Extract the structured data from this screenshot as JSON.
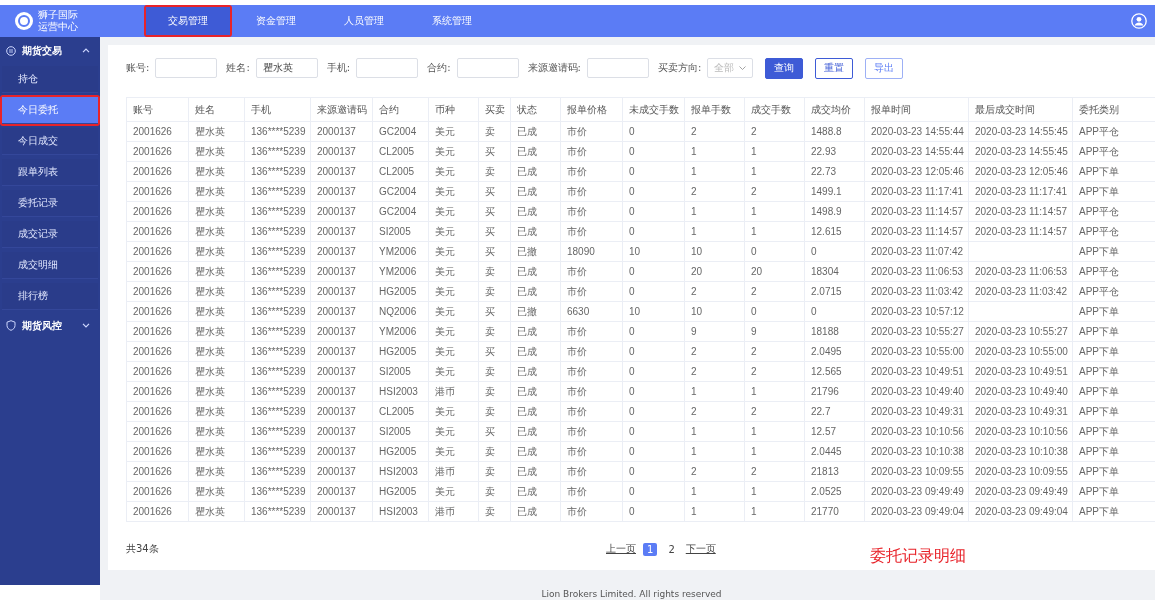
{
  "header": {
    "logo_lines": [
      "狮子国际",
      "运营中心"
    ],
    "tabs": [
      {
        "label": "交易管理",
        "selected": true,
        "annotated": true
      },
      {
        "label": "资金管理",
        "selected": false,
        "annotated": false
      },
      {
        "label": "人员管理",
        "selected": false,
        "annotated": false
      },
      {
        "label": "系统管理",
        "selected": false,
        "annotated": false
      }
    ]
  },
  "sidebar": {
    "groups": [
      {
        "label": "期货交易",
        "expanded": true,
        "items": [
          {
            "label": "持仓",
            "selected": false,
            "annotated": false
          },
          {
            "label": "今日委托",
            "selected": true,
            "annotated": true
          },
          {
            "label": "今日成交",
            "selected": false,
            "annotated": false
          },
          {
            "label": "跟单列表",
            "selected": false,
            "annotated": false
          },
          {
            "label": "委托记录",
            "selected": false,
            "annotated": false
          },
          {
            "label": "成交记录",
            "selected": false,
            "annotated": false
          },
          {
            "label": "成交明细",
            "selected": false,
            "annotated": false
          },
          {
            "label": "排行榜",
            "selected": false,
            "annotated": false
          }
        ]
      },
      {
        "label": "期货风控",
        "expanded": false
      }
    ]
  },
  "filters": [
    {
      "label": "账号:",
      "kind": "input"
    },
    {
      "label": "姓名:",
      "kind": "input",
      "value": "瞿水英"
    },
    {
      "label": "手机:",
      "kind": "input"
    },
    {
      "label": "合约:",
      "kind": "input"
    },
    {
      "label": "来源邀请码:",
      "kind": "input"
    },
    {
      "label": "买卖方向:",
      "kind": "select",
      "placeholder": "全部"
    }
  ],
  "buttons": [
    {
      "label": "查询",
      "kind": "primary"
    },
    {
      "label": "重置",
      "kind": "outline"
    },
    {
      "label": "导出",
      "kind": "light"
    }
  ],
  "table": {
    "columns": [
      "账号",
      "姓名",
      "手机",
      "来源邀请码",
      "合约",
      "币种",
      "买卖",
      "状态",
      "报单价格",
      "未成交手数",
      "报单手数",
      "成交手数",
      "成交均价",
      "报单时间",
      "最后成交时间",
      "委托类别"
    ],
    "rows": [
      [
        "2001626",
        "瞿水英",
        "136****5239",
        "2000137",
        "GC2004",
        "美元",
        "卖",
        "已成",
        "市价",
        "0",
        "2",
        "2",
        "1488.8",
        "2020-03-23 14:55:44",
        "2020-03-23 14:55:45",
        "APP平仓"
      ],
      [
        "2001626",
        "瞿水英",
        "136****5239",
        "2000137",
        "CL2005",
        "美元",
        "买",
        "已成",
        "市价",
        "0",
        "1",
        "1",
        "22.93",
        "2020-03-23 14:55:44",
        "2020-03-23 14:55:45",
        "APP平仓"
      ],
      [
        "2001626",
        "瞿水英",
        "136****5239",
        "2000137",
        "CL2005",
        "美元",
        "卖",
        "已成",
        "市价",
        "0",
        "1",
        "1",
        "22.73",
        "2020-03-23 12:05:46",
        "2020-03-23 12:05:46",
        "APP下单"
      ],
      [
        "2001626",
        "瞿水英",
        "136****5239",
        "2000137",
        "GC2004",
        "美元",
        "买",
        "已成",
        "市价",
        "0",
        "2",
        "2",
        "1499.1",
        "2020-03-23 11:17:41",
        "2020-03-23 11:17:41",
        "APP下单"
      ],
      [
        "2001626",
        "瞿水英",
        "136****5239",
        "2000137",
        "GC2004",
        "美元",
        "买",
        "已成",
        "市价",
        "0",
        "1",
        "1",
        "1498.9",
        "2020-03-23 11:14:57",
        "2020-03-23 11:14:57",
        "APP平仓"
      ],
      [
        "2001626",
        "瞿水英",
        "136****5239",
        "2000137",
        "SI2005",
        "美元",
        "买",
        "已成",
        "市价",
        "0",
        "1",
        "1",
        "12.615",
        "2020-03-23 11:14:57",
        "2020-03-23 11:14:57",
        "APP平仓"
      ],
      [
        "2001626",
        "瞿水英",
        "136****5239",
        "2000137",
        "YM2006",
        "美元",
        "买",
        "已撤",
        "18090",
        "10",
        "10",
        "0",
        "0",
        "2020-03-23 11:07:42",
        null,
        "APP下单"
      ],
      [
        "2001626",
        "瞿水英",
        "136****5239",
        "2000137",
        "YM2006",
        "美元",
        "卖",
        "已成",
        "市价",
        "0",
        "20",
        "20",
        "18304",
        "2020-03-23 11:06:53",
        "2020-03-23 11:06:53",
        "APP平仓"
      ],
      [
        "2001626",
        "瞿水英",
        "136****5239",
        "2000137",
        "HG2005",
        "美元",
        "卖",
        "已成",
        "市价",
        "0",
        "2",
        "2",
        "2.0715",
        "2020-03-23 11:03:42",
        "2020-03-23 11:03:42",
        "APP平仓"
      ],
      [
        "2001626",
        "瞿水英",
        "136****5239",
        "2000137",
        "NQ2006",
        "美元",
        "买",
        "已撤",
        "6630",
        "10",
        "10",
        "0",
        "0",
        "2020-03-23 10:57:12",
        null,
        "APP下单"
      ],
      [
        "2001626",
        "瞿水英",
        "136****5239",
        "2000137",
        "YM2006",
        "美元",
        "卖",
        "已成",
        "市价",
        "0",
        "9",
        "9",
        "18188",
        "2020-03-23 10:55:27",
        "2020-03-23 10:55:27",
        "APP下单"
      ],
      [
        "2001626",
        "瞿水英",
        "136****5239",
        "2000137",
        "HG2005",
        "美元",
        "买",
        "已成",
        "市价",
        "0",
        "2",
        "2",
        "2.0495",
        "2020-03-23 10:55:00",
        "2020-03-23 10:55:00",
        "APP下单"
      ],
      [
        "2001626",
        "瞿水英",
        "136****5239",
        "2000137",
        "SI2005",
        "美元",
        "卖",
        "已成",
        "市价",
        "0",
        "2",
        "2",
        "12.565",
        "2020-03-23 10:49:51",
        "2020-03-23 10:49:51",
        "APP下单"
      ],
      [
        "2001626",
        "瞿水英",
        "136****5239",
        "2000137",
        "HSI2003",
        "港币",
        "卖",
        "已成",
        "市价",
        "0",
        "1",
        "1",
        "21796",
        "2020-03-23 10:49:40",
        "2020-03-23 10:49:40",
        "APP下单"
      ],
      [
        "2001626",
        "瞿水英",
        "136****5239",
        "2000137",
        "CL2005",
        "美元",
        "卖",
        "已成",
        "市价",
        "0",
        "2",
        "2",
        "22.7",
        "2020-03-23 10:49:31",
        "2020-03-23 10:49:31",
        "APP下单"
      ],
      [
        "2001626",
        "瞿水英",
        "136****5239",
        "2000137",
        "SI2005",
        "美元",
        "买",
        "已成",
        "市价",
        "0",
        "1",
        "1",
        "12.57",
        "2020-03-23 10:10:56",
        "2020-03-23 10:10:56",
        "APP下单"
      ],
      [
        "2001626",
        "瞿水英",
        "136****5239",
        "2000137",
        "HG2005",
        "美元",
        "卖",
        "已成",
        "市价",
        "0",
        "1",
        "1",
        "2.0445",
        "2020-03-23 10:10:38",
        "2020-03-23 10:10:38",
        "APP下单"
      ],
      [
        "2001626",
        "瞿水英",
        "136****5239",
        "2000137",
        "HSI2003",
        "港币",
        "卖",
        "已成",
        "市价",
        "0",
        "2",
        "2",
        "21813",
        "2020-03-23 10:09:55",
        "2020-03-23 10:09:55",
        "APP下单"
      ],
      [
        "2001626",
        "瞿水英",
        "136****5239",
        "2000137",
        "HG2005",
        "美元",
        "卖",
        "已成",
        "市价",
        "0",
        "1",
        "1",
        "2.0525",
        "2020-03-23 09:49:49",
        "2020-03-23 09:49:49",
        "APP下单"
      ],
      [
        "2001626",
        "瞿水英",
        "136****5239",
        "2000137",
        "HSI2003",
        "港币",
        "卖",
        "已成",
        "市价",
        "0",
        "1",
        "1",
        "21770",
        "2020-03-23 09:49:04",
        "2020-03-23 09:49:04",
        "APP下单"
      ]
    ]
  },
  "total": "共34条",
  "pagination": {
    "prev": "上一页",
    "pages": [
      {
        "label": "1",
        "selected": true
      },
      {
        "label": "2",
        "selected": false
      }
    ],
    "next": "下一页"
  },
  "annotation": "委托记录明细",
  "footer": "Lion Brokers Limited. All rights reserved"
}
